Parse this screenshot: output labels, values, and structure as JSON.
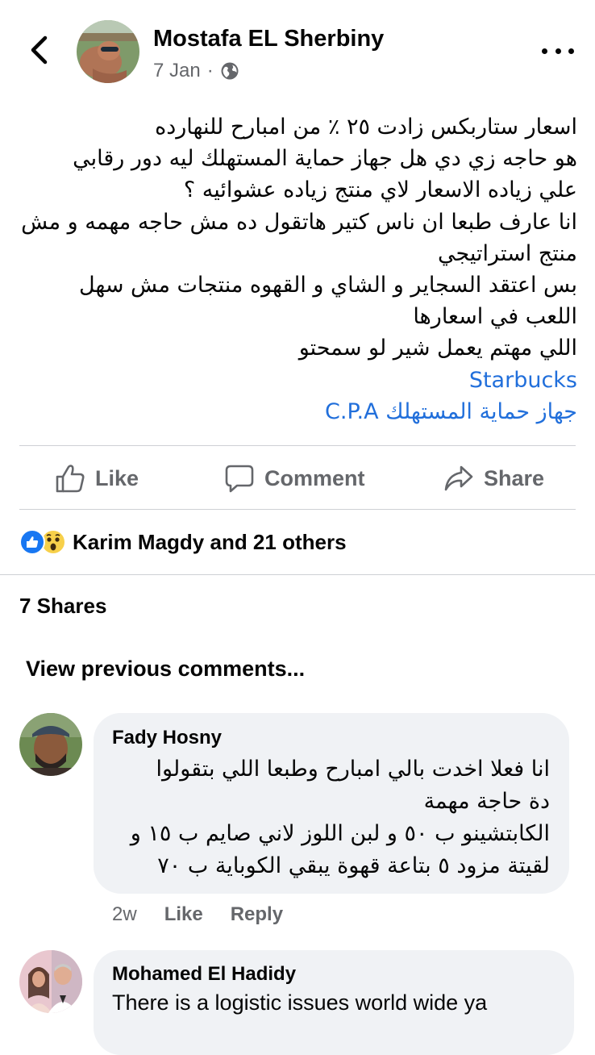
{
  "post": {
    "author": "Mostafa EL Sherbiny",
    "date": "7 Jan",
    "separator": "·",
    "privacy_icon": "globe-icon",
    "lines": [
      "اسعار ستاربكس زادت  ٢٥ ٪ من امبارح للنهارده",
      "هو حاجه زي دي هل جهاز حماية المستهلك ليه دور رقابي",
      "علي زياده الاسعار لاي منتج زياده عشوائيه ؟",
      "انا عارف طبعا ان ناس كتير هاتقول ده مش حاجه مهمه و مش",
      "منتج استراتيجي",
      "بس اعتقد السجاير و الشاي و القهوه منتجات مش سهل",
      "اللعب في اسعارها",
      "اللي مهتم يعمل شير لو سمحتو"
    ],
    "links": [
      "Starbucks",
      "جهاز حماية المستهلك C.P.A"
    ],
    "link_color": "#216fdb"
  },
  "actions": {
    "like": "Like",
    "comment": "Comment",
    "share": "Share"
  },
  "reactions": {
    "text": "Karim Magdy and 21 others",
    "icons": [
      "like-reaction-icon",
      "wow-reaction-icon"
    ]
  },
  "shares": "7 Shares",
  "view_previous": "View previous comments...",
  "comments": [
    {
      "name": "Fady Hosny",
      "lines": [
        "انا فعلا اخدت بالي امبارح وطبعا اللي بتقولوا",
        "دة حاجة مهمة",
        "الكابتشينو ب ٥٠ و لبن اللوز لاني صايم ب ١٥ و",
        "لقيتة مزود ٥ بتاعة قهوة يبقي الكوباية ب ٧٠"
      ],
      "time": "2w",
      "like": "Like",
      "reply": "Reply"
    },
    {
      "name": "Mohamed El Hadidy",
      "text": "There is a logistic issues world wide ya"
    }
  ],
  "colors": {
    "text": "#050505",
    "secondary": "#65676b",
    "bubble": "#f0f2f5",
    "like_blue": "#1877f2"
  }
}
